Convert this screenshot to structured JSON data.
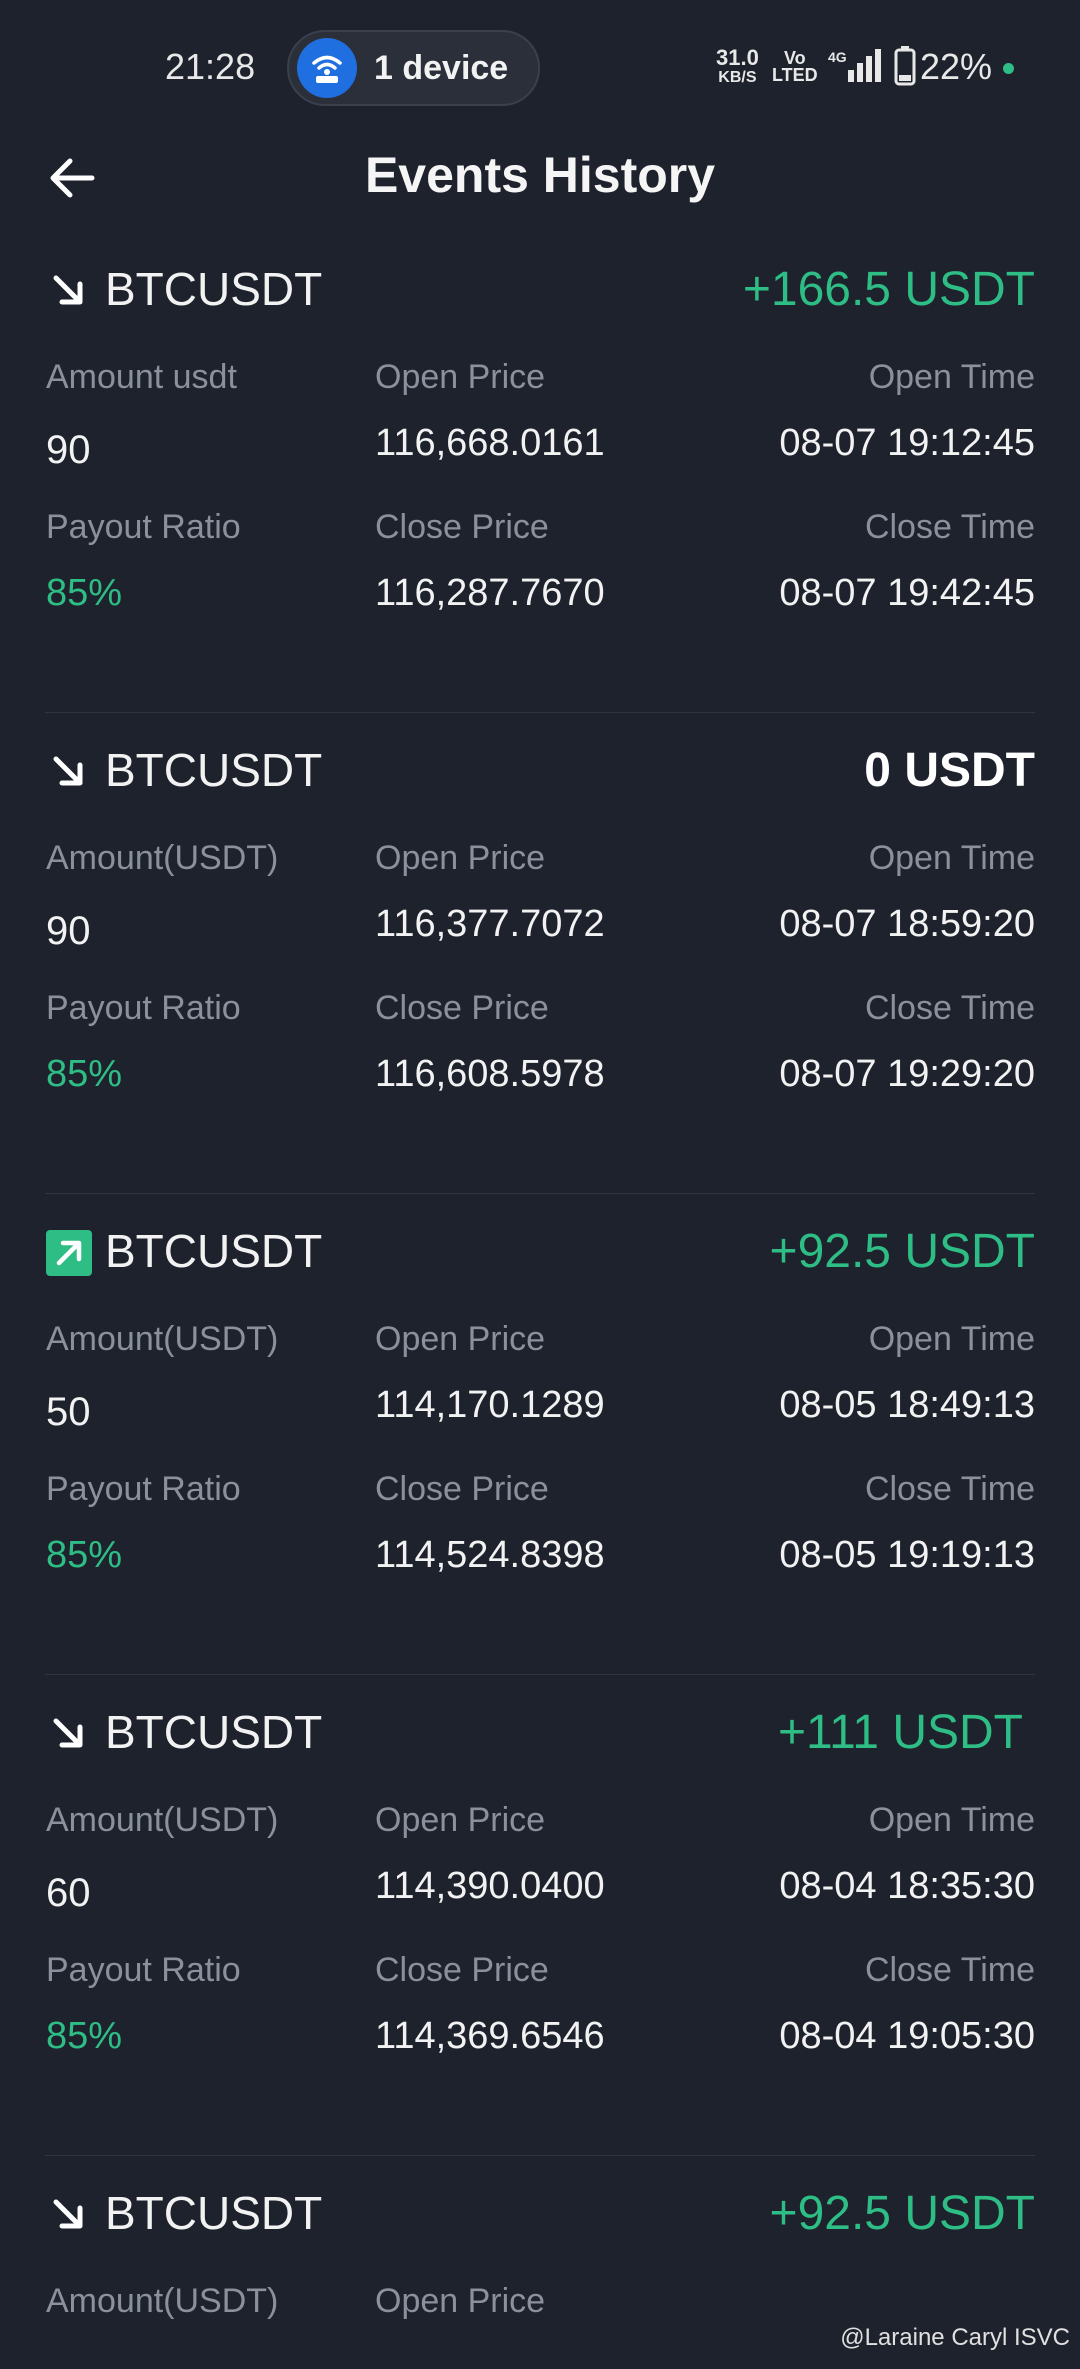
{
  "status_bar": {
    "time": "21:28",
    "hotspot_label": "1 device",
    "net_speed": "31.0",
    "net_unit": "KB/S",
    "volte_top": "Vo",
    "volte_bottom": "LTED",
    "network_type": "4G",
    "battery": "22%",
    "dot_color": "#2ebd85"
  },
  "header": {
    "title": "Events History"
  },
  "events": [
    {
      "direction": "down",
      "symbol": "BTCUSDT",
      "pnl": "+166.5 USDT",
      "amount_label": "Amount usdt",
      "amount": "90",
      "open_price_label": "Open Price",
      "open_price": "116,668.0161",
      "open_time_label": "Open Time",
      "open_time": "08-07 19:12:45",
      "payout_label": "Payout Ratio",
      "payout": "85%",
      "close_price_label": "Close Price",
      "close_price": "116,287.7670",
      "close_time_label": "Close Time",
      "close_time": "08-07 19:42:45"
    },
    {
      "direction": "down",
      "symbol": "BTCUSDT",
      "pnl": "0 USDT",
      "amount_label": "Amount(USDT)",
      "amount": "90",
      "open_price_label": "Open Price",
      "open_price": "116,377.7072",
      "open_time_label": "Open Time",
      "open_time": "08-07 18:59:20",
      "payout_label": "Payout Ratio",
      "payout": "85%",
      "close_price_label": "Close Price",
      "close_price": "116,608.5978",
      "close_time_label": "Close Time",
      "close_time": "08-07 19:29:20"
    },
    {
      "direction": "up",
      "symbol": "BTCUSDT",
      "pnl": "+92.5 USDT",
      "amount_label": "Amount(USDT)",
      "amount": "50",
      "open_price_label": "Open Price",
      "open_price": "114,170.1289",
      "open_time_label": "Open Time",
      "open_time": "08-05 18:49:13",
      "payout_label": "Payout Ratio",
      "payout": "85%",
      "close_price_label": "Close Price",
      "close_price": "114,524.8398",
      "close_time_label": "Close Time",
      "close_time": "08-05 19:19:13"
    },
    {
      "direction": "down",
      "symbol": "BTCUSDT",
      "pnl": "+111 USDT",
      "amount_label": "Amount(USDT)",
      "amount": "60",
      "open_price_label": "Open Price",
      "open_price": "114,390.0400",
      "open_time_label": "Open Time",
      "open_time": "08-04 18:35:30",
      "payout_label": "Payout Ratio",
      "payout": "85%",
      "close_price_label": "Close Price",
      "close_price": "114,369.6546",
      "close_time_label": "Close Time",
      "close_time": "08-04 19:05:30"
    },
    {
      "direction": "down",
      "symbol": "BTCUSDT",
      "pnl": "+92.5 USDT",
      "amount_label": "Amount(USDT)",
      "open_price_label": "Open Price"
    }
  ],
  "watermark": "@Laraine Caryl ISVC",
  "colors": {
    "background": "#1e222d",
    "positive": "#2ebd85",
    "label": "#8a909c"
  }
}
